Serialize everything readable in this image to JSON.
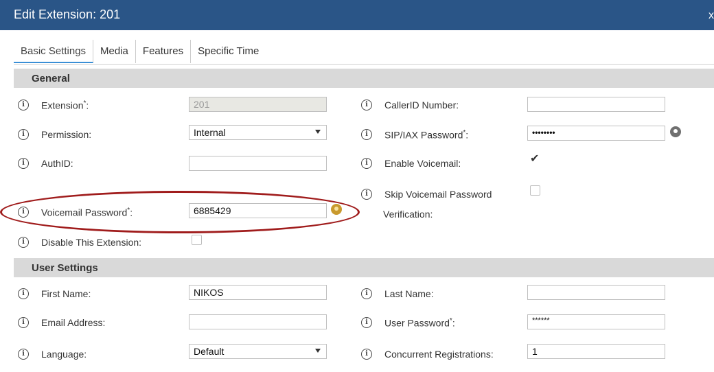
{
  "window": {
    "title": "Edit Extension: 201",
    "close_label": "x"
  },
  "tabs": [
    {
      "label": "Basic Settings",
      "active": true
    },
    {
      "label": "Media"
    },
    {
      "label": "Features"
    },
    {
      "label": "Specific Time"
    }
  ],
  "sections": {
    "general": "General",
    "user_settings": "User Settings"
  },
  "general": {
    "extension": {
      "label": "Extension",
      "value": "201"
    },
    "permission": {
      "label": "Permission:",
      "value": "Internal"
    },
    "authid": {
      "label": "AuthID:",
      "value": ""
    },
    "voicemail_password": {
      "label": "Voicemail Password",
      "value": "6885429"
    },
    "disable_extension": {
      "label": "Disable This Extension:",
      "checked": false
    },
    "callerid_number": {
      "label": "CallerID Number:",
      "value": ""
    },
    "sip_password": {
      "label": "SIP/IAX Password",
      "value": "••••••••"
    },
    "enable_voicemail": {
      "label": "Enable Voicemail:",
      "checked": true
    },
    "skip_voicemail": {
      "label_line1": "Skip Voicemail Password",
      "label_line2": "Verification:",
      "checked": false
    }
  },
  "user_settings": {
    "first_name": {
      "label": "First Name:",
      "value": "NIKOS"
    },
    "email": {
      "label": "Email Address:",
      "value": ""
    },
    "language": {
      "label": "Language:",
      "value": "Default"
    },
    "last_name": {
      "label": "Last Name:",
      "value": ""
    },
    "user_password": {
      "label": "User Password",
      "value": "******"
    },
    "concurrent_registrations": {
      "label": "Concurrent Registrations:",
      "value": "1"
    }
  },
  "glyphs": {
    "info": "i",
    "required": "*",
    "colon": ":",
    "check": "✔"
  },
  "colors": {
    "titlebar": "#2a5587",
    "section": "#d9d9d9",
    "highlight_ellipse": "#a01c1c",
    "tab_active": "#3a8fd6"
  }
}
